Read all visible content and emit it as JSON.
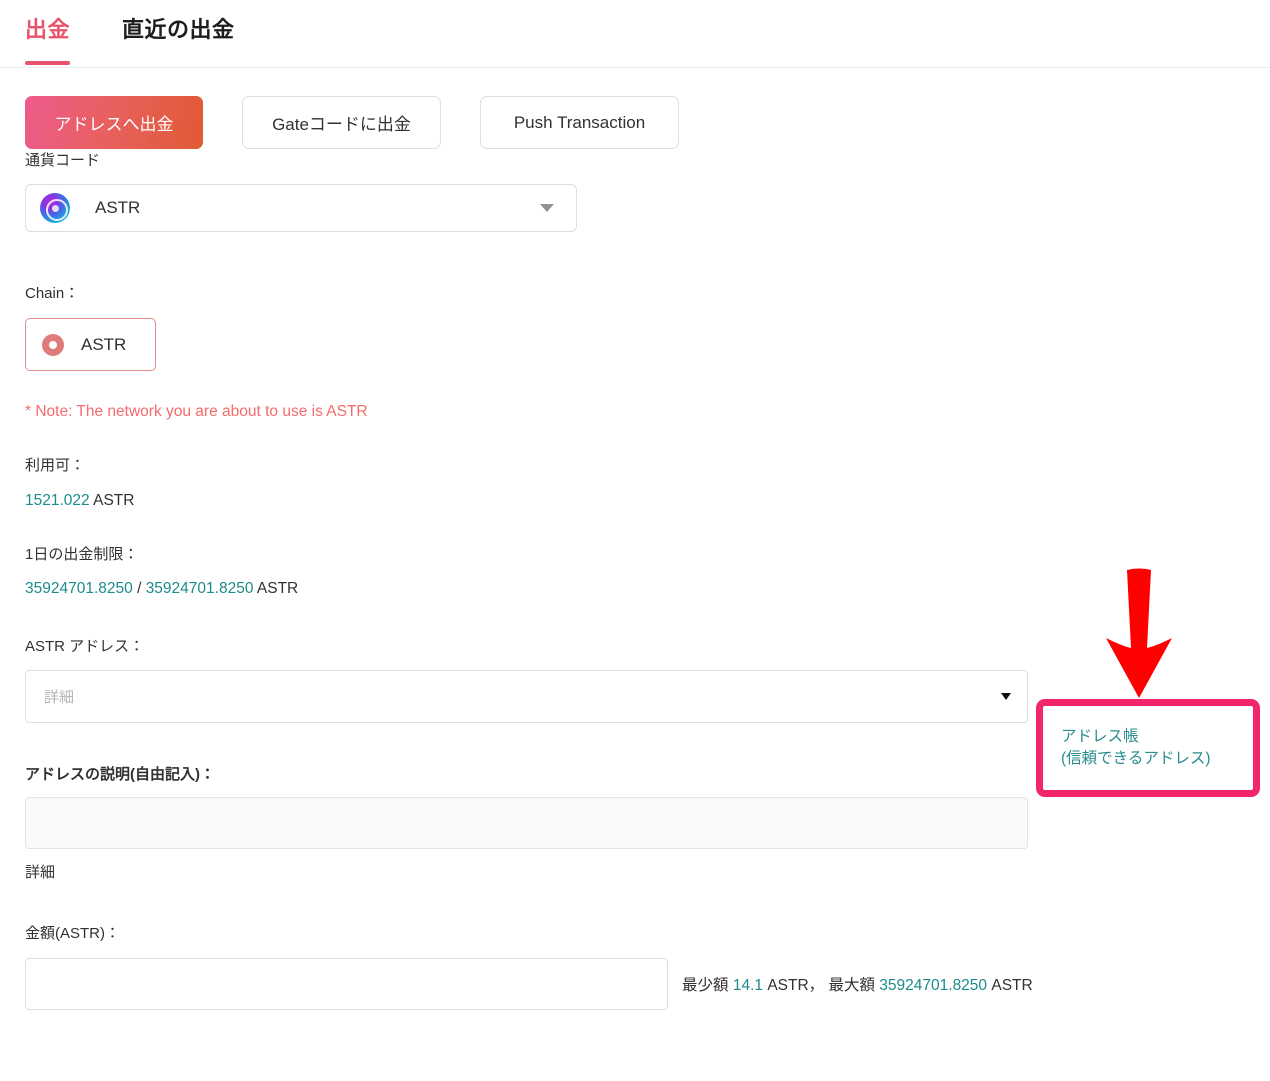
{
  "tabs": [
    {
      "label": "出金",
      "active": true
    },
    {
      "label": "直近の出金",
      "active": false
    }
  ],
  "actions": {
    "withdraw_to_address": "アドレスへ出金",
    "withdraw_to_gate_code": "Gateコードに出金",
    "push_transaction": "Push Transaction"
  },
  "form": {
    "currency_label": "通貨コード",
    "currency_value": "ASTR",
    "currency_icon": "astr-coin-icon",
    "chain_label": "Chain：",
    "chain_value": "ASTR",
    "note": "* Note: The network you are about to use is ASTR",
    "available_label": "利用可：",
    "available_amount": "1521.022",
    "available_unit": "ASTR",
    "daily_limit_label": "1日の出金制限：",
    "daily_limit_used": "35924701.8250",
    "daily_limit_separator": " / ",
    "daily_limit_total": "35924701.8250",
    "daily_limit_unit": "ASTR",
    "address_label": "ASTR アドレス：",
    "address_placeholder": "詳細",
    "address_value": "",
    "description_label": "アドレスの説明(自由記入)：",
    "description_value": "",
    "description_help": "詳細",
    "amount_label": "金額(ASTR)：",
    "amount_value": "",
    "amount_hint_min_label": "最少額",
    "amount_hint_min_value": "14.1",
    "amount_hint_min_unit": "ASTR，",
    "amount_hint_max_label": "最大額",
    "amount_hint_max_value": "35924701.8250",
    "amount_hint_max_unit": "ASTR"
  },
  "address_book": {
    "line1": "アドレス帳",
    "line2": "(信頼できるアドレス)"
  },
  "annotation": {
    "arrow": "red-down-arrow-icon",
    "arrow_color": "#ff0000",
    "highlight_color": "#f2246b"
  },
  "colors": {
    "accent_pink": "#e8546b",
    "note_red": "#f56c6c",
    "teal": "#1d8b8b",
    "gradient_start": "#ee5b8b",
    "gradient_end": "#e05a35"
  }
}
